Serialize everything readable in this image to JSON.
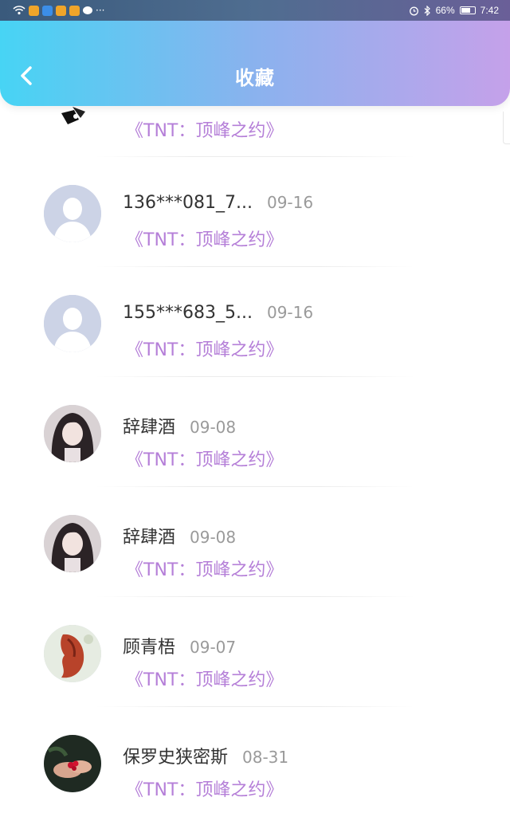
{
  "status_bar": {
    "battery": "66%",
    "time": "7:42",
    "more": "···"
  },
  "header": {
    "title": "收藏",
    "back_icon": "chevron-left-icon"
  },
  "colors": {
    "header_start": "#47d4f4",
    "header_end": "#c5a1ea",
    "fav_title": "#b57fd8"
  },
  "favorites": [
    {
      "name": "",
      "date": "",
      "title": "《TNT：顶峰之约》",
      "avatar": "partial-photo"
    },
    {
      "name": "136***081_7...",
      "date": "09-16",
      "title": "《TNT：顶峰之约》",
      "avatar": "default-user"
    },
    {
      "name": "155***683_5...",
      "date": "09-16",
      "title": "《TNT：顶峰之约》",
      "avatar": "default-user"
    },
    {
      "name": "辞肆酒",
      "date": "09-08",
      "title": "《TNT：顶峰之约》",
      "avatar": "girl-photo"
    },
    {
      "name": "辞肆酒",
      "date": "09-08",
      "title": "《TNT：顶峰之约》",
      "avatar": "girl-photo"
    },
    {
      "name": "顾青梧",
      "date": "09-07",
      "title": "《TNT：顶峰之约》",
      "avatar": "red-figure-photo"
    },
    {
      "name": "保罗史狭密斯",
      "date": "08-31",
      "title": "《TNT：顶峰之约》",
      "avatar": "hands-photo"
    }
  ]
}
